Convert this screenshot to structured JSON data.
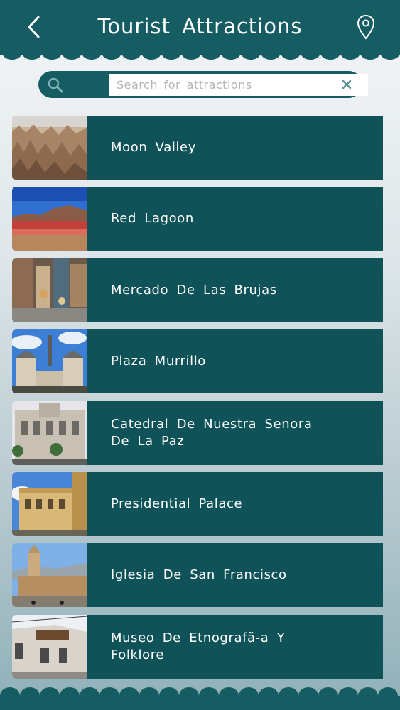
{
  "header": {
    "title": "Tourist Attractions"
  },
  "search": {
    "placeholder": "Search for attractions",
    "value": ""
  },
  "attractions": [
    {
      "label": "Moon Valley"
    },
    {
      "label": "Red Lagoon"
    },
    {
      "label": "Mercado De Las Brujas"
    },
    {
      "label": "Plaza Murrillo"
    },
    {
      "label": "Catedral De Nuestra Senora De La Paz"
    },
    {
      "label": "Presidential Palace"
    },
    {
      "label": "Iglesia De San Francisco"
    },
    {
      "label": "Museo De Etnografã-a Y Folklore"
    }
  ],
  "colors": {
    "header": "#155d63",
    "card": "#0f5258",
    "text": "#ffffff"
  },
  "icons": {
    "back": "chevron-left-icon",
    "location": "map-pin-icon",
    "search": "magnifier-icon",
    "clear": "close-icon"
  }
}
